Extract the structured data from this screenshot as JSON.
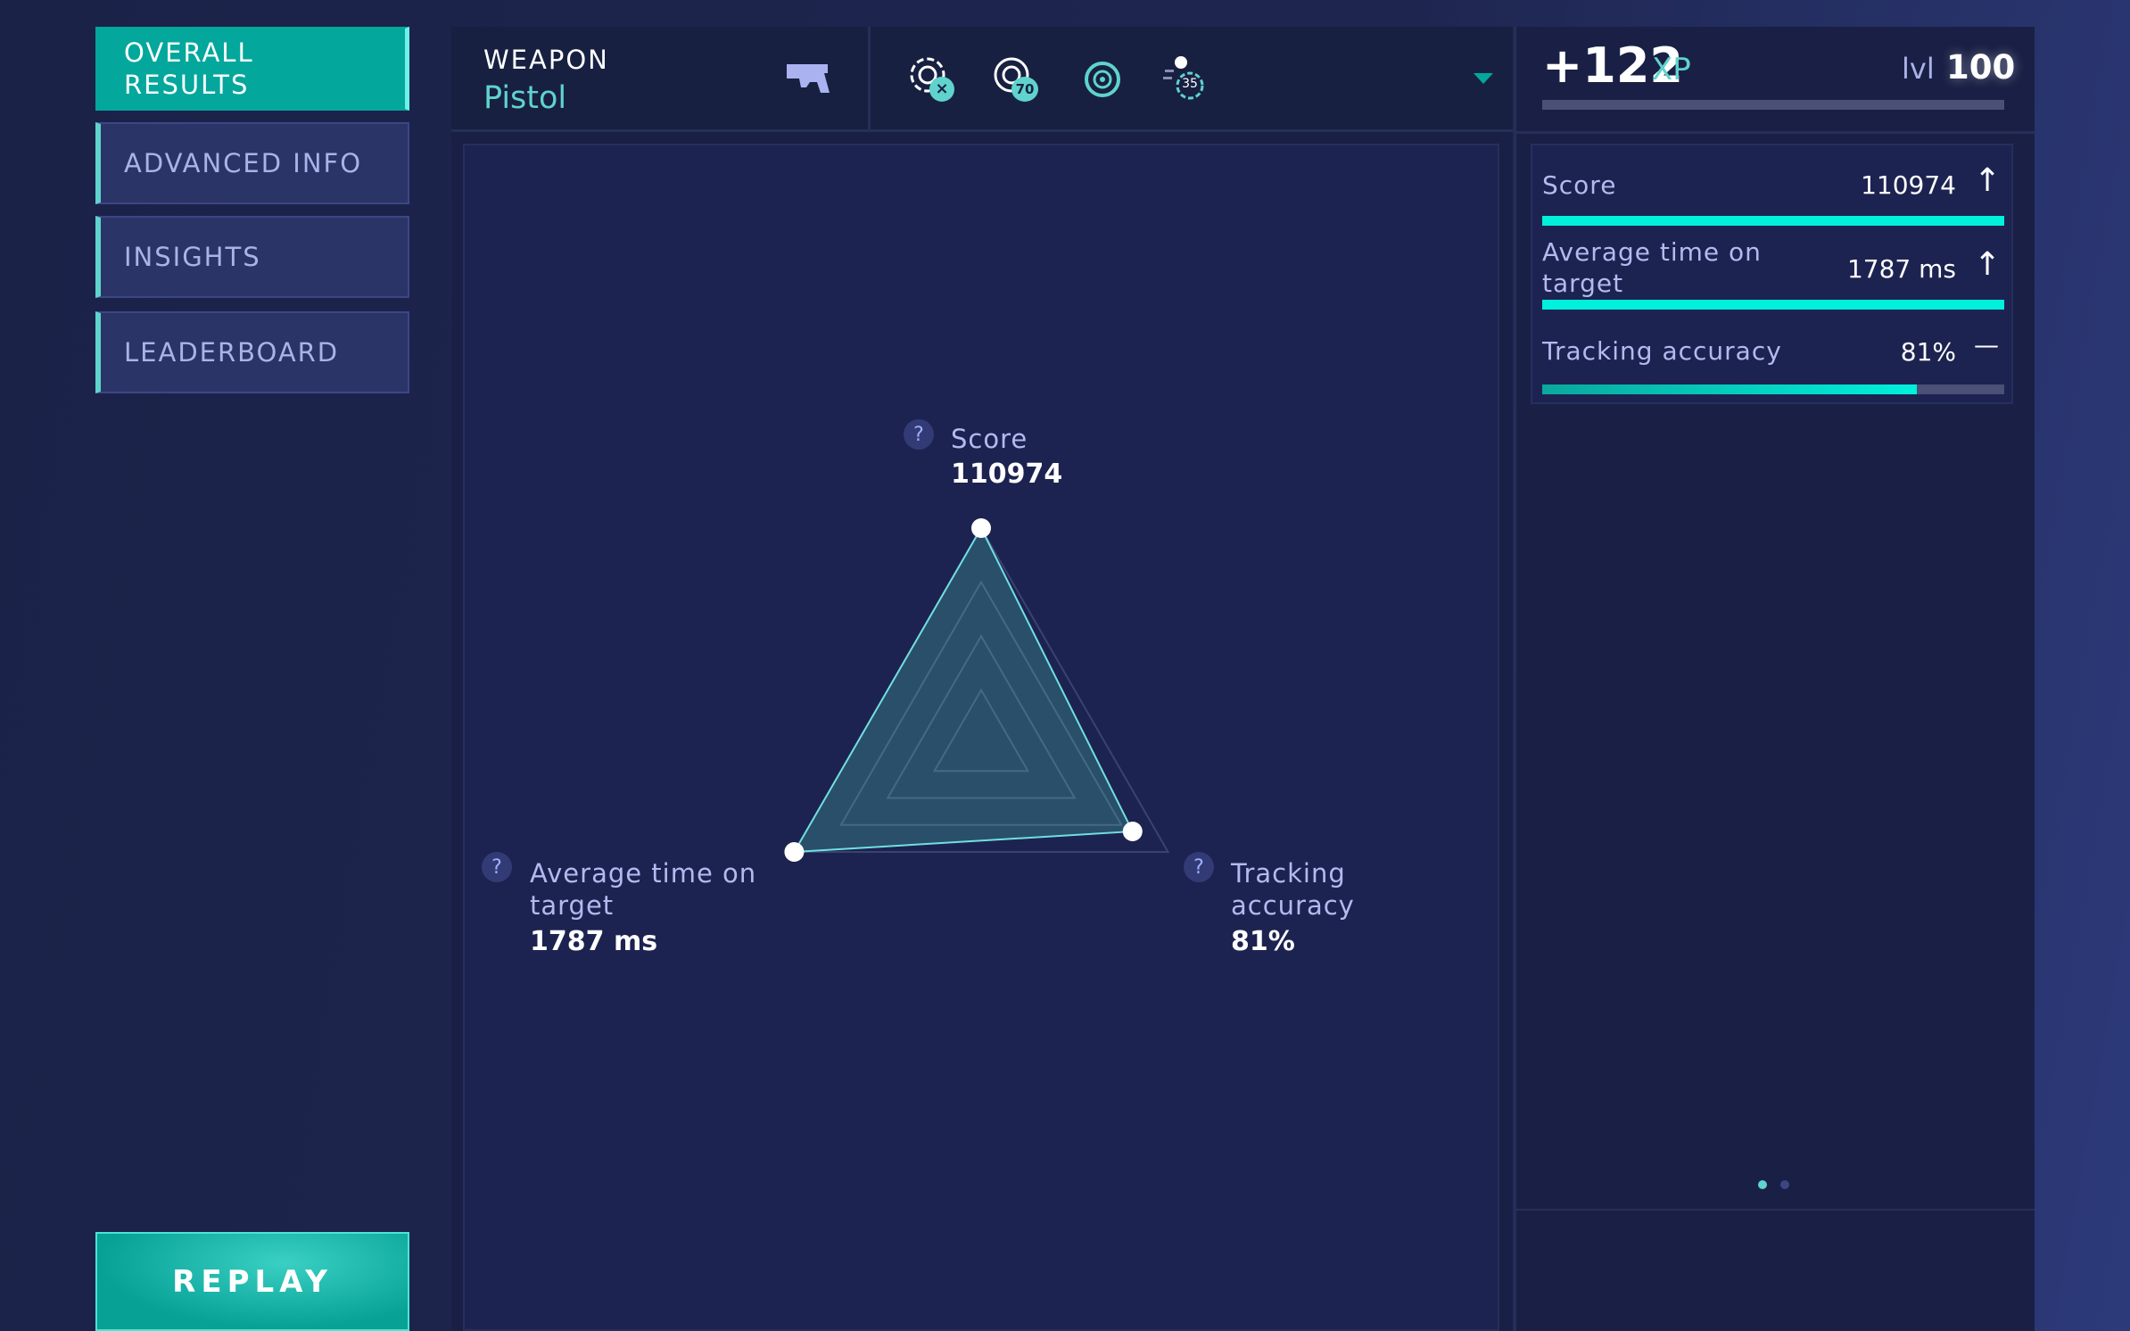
{
  "nav": {
    "items": [
      {
        "label": "OVERALL\nRESULTS",
        "active": true
      },
      {
        "label": "ADVANCED INFO"
      },
      {
        "label": "INSIGHTS"
      },
      {
        "label": "LEADERBOARD"
      }
    ],
    "replay": "REPLAY"
  },
  "weapon": {
    "heading": "WEAPON",
    "name": "Pistol",
    "icon": "pistol-icon"
  },
  "modes": [
    {
      "icon": "target-miss-icon",
      "badge": "×"
    },
    {
      "icon": "target-hits-icon",
      "badge": "70"
    },
    {
      "icon": "bullseye-icon"
    },
    {
      "icon": "moving-target-icon",
      "badge": "35"
    }
  ],
  "xp": {
    "gain": "+122",
    "unit": "XP",
    "lvl_label": "lvl",
    "level": "100",
    "progress": 0
  },
  "stats": [
    {
      "label": "Score",
      "value": "110974",
      "trend": "↑",
      "fill": 1.0
    },
    {
      "label": "Average time on target",
      "value": "1787 ms",
      "trend": "↑",
      "fill": 1.0
    },
    {
      "label": "Tracking accuracy",
      "value": "81%",
      "trend": "—",
      "fill": 0.81
    }
  ],
  "radar": {
    "axes": [
      {
        "label": "Score",
        "value": "110974",
        "norm": 1.0
      },
      {
        "label": "Tracking accuracy",
        "value": "81%",
        "norm": 0.81
      },
      {
        "label": "Average time on target",
        "value": "1787 ms",
        "norm": 1.0
      }
    ],
    "help": "?"
  },
  "pager": {
    "pages": 2,
    "current": 1
  },
  "colors": {
    "accent": "#00f0dc",
    "teal": "#04a79c"
  }
}
